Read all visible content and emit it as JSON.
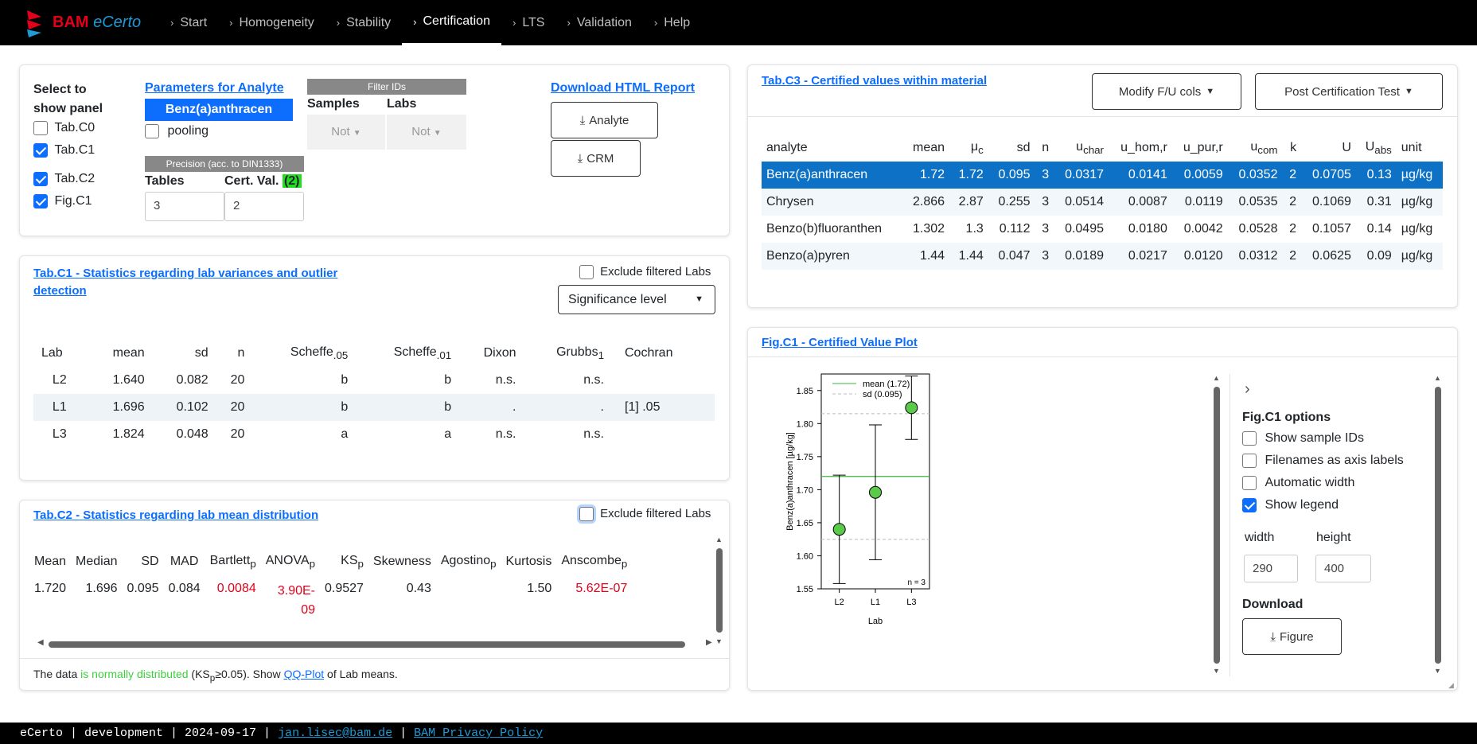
{
  "app": {
    "brand_a": "BAM",
    "brand_b": "eCerto"
  },
  "nav": {
    "items": [
      "Start",
      "Homogeneity",
      "Stability",
      "Certification",
      "LTS",
      "Validation",
      "Help"
    ],
    "active": "Certification"
  },
  "top": {
    "select_label": "Select to show panel",
    "checks": [
      {
        "label": "Tab.C0",
        "on": false
      },
      {
        "label": "Tab.C1",
        "on": true
      },
      {
        "label": "Tab.C2",
        "on": true
      },
      {
        "label": "Fig.C1",
        "on": true
      }
    ],
    "params_title": "Parameters for Analyte",
    "analyte": "Benz(a)anthracen",
    "pooling": "pooling",
    "filter_ids": "Filter IDs",
    "samples": "Samples",
    "labs": "Labs",
    "not1": "Not",
    "not2": "Not",
    "precision": "Precision (acc. to DIN1333)",
    "tables": "Tables",
    "cert_val": "Cert. Val.",
    "cert_badge": "(2)",
    "tables_val": "3",
    "cert_val_val": "2",
    "download_title": "Download HTML Report",
    "analyte_btn": "Analyte",
    "crm_btn": "CRM"
  },
  "c1": {
    "title_1": "Tab.C1 - Statistics regarding lab variances and outlier",
    "title_2": "detection",
    "exclude": "Exclude filtered Labs",
    "significance": "Significance level",
    "headers": [
      "Lab",
      "mean",
      "sd",
      "n",
      "Scheffe",
      "Scheffe",
      "Dixon",
      "Grubbs",
      "Cochran"
    ],
    "sub_05": ".05",
    "sub_01": ".01",
    "sub_1": "1",
    "rows": [
      [
        "L2",
        "1.640",
        "0.082",
        "20",
        "b",
        "b",
        "n.s.",
        "n.s.",
        ""
      ],
      [
        "L1",
        "1.696",
        "0.102",
        "20",
        "b",
        "b",
        ".",
        ".",
        "[1] .05"
      ],
      [
        "L3",
        "1.824",
        "0.048",
        "20",
        "a",
        "a",
        "n.s.",
        "n.s.",
        ""
      ]
    ]
  },
  "c2": {
    "title": "Tab.C2 - Statistics regarding lab mean distribution",
    "exclude": "Exclude filtered Labs",
    "headers": [
      "Mean",
      "Median",
      "SD",
      "MAD",
      "Bartlett",
      "ANOVA",
      "KS",
      "Skewness",
      "Agostino",
      "Kurtosis",
      "Anscombe"
    ],
    "sub_p": "p",
    "values": [
      "1.720",
      "1.696",
      "0.095",
      "0.084",
      "0.0084",
      "3.90E-09",
      "0.9527",
      "0.43",
      "",
      "1.50",
      "5.62E-07"
    ],
    "anova_1": "3.90E-",
    "anova_2": "09",
    "note_a": "The data ",
    "note_b": "is normally distributed",
    "note_c": " (KS",
    "note_p": "p",
    "note_d": "≥0.05). Show ",
    "note_link": "QQ-Plot",
    "note_e": " of Lab means."
  },
  "c3": {
    "title": "Tab.C3 - Certified values within material",
    "modify_btn": "Modify F/U cols",
    "post_btn": "Post Certification Test",
    "headers": [
      "analyte",
      "mean",
      "μ",
      "sd",
      "n",
      "u",
      "u_hom,r",
      "u_pur,r",
      "u",
      "k",
      "U",
      "U",
      "unit"
    ],
    "sub_c": "c",
    "sub_char": "char",
    "sub_com": "com",
    "sub_abs": "abs",
    "rows": [
      [
        "Benz(a)anthracen",
        "1.72",
        "1.72",
        "0.095",
        "3",
        "0.0317",
        "0.0141",
        "0.0059",
        "0.0352",
        "2",
        "0.0705",
        "0.13",
        "µg/kg"
      ],
      [
        "Chrysen",
        "2.866",
        "2.87",
        "0.255",
        "3",
        "0.0514",
        "0.0087",
        "0.0119",
        "0.0535",
        "2",
        "0.1069",
        "0.31",
        "µg/kg"
      ],
      [
        "Benzo(b)fluoranthen",
        "1.302",
        "1.3",
        "0.112",
        "3",
        "0.0495",
        "0.0180",
        "0.0042",
        "0.0528",
        "2",
        "0.1057",
        "0.14",
        "µg/kg"
      ],
      [
        "Benzo(a)pyren",
        "1.44",
        "1.44",
        "0.047",
        "3",
        "0.0189",
        "0.0217",
        "0.0120",
        "0.0312",
        "2",
        "0.0625",
        "0.09",
        "µg/kg"
      ]
    ]
  },
  "fig": {
    "title": "Fig.C1 - Certified Value Plot",
    "options_title": "Fig.C1 options",
    "opts": [
      {
        "label": "Show sample IDs",
        "on": false
      },
      {
        "label": "Filenames as axis labels",
        "on": false
      },
      {
        "label": "Automatic width",
        "on": false
      },
      {
        "label": "Show legend",
        "on": true
      }
    ],
    "width_label": "width",
    "height_label": "height",
    "width_val": "290",
    "height_val": "400",
    "download": "Download",
    "figure_btn": "Figure"
  },
  "chart_data": {
    "type": "scatter",
    "categories": [
      "L2",
      "L1",
      "L3"
    ],
    "values": [
      1.64,
      1.696,
      1.824
    ],
    "error_low": [
      1.558,
      1.594,
      1.776
    ],
    "error_high": [
      1.722,
      1.798,
      1.872
    ],
    "mean": 1.72,
    "sd": 0.095,
    "legend": [
      "mean (1.72)",
      "sd (0.095)"
    ],
    "annotation": "n = 3",
    "xlabel": "Lab",
    "ylabel": "Benz(a)anthracen [µg/kg]",
    "yticks": [
      "1.55",
      "1.60",
      "1.65",
      "1.70",
      "1.75",
      "1.80",
      "1.85"
    ],
    "ylim": [
      1.55,
      1.875
    ],
    "point_color": "#5bc94a",
    "mean_color": "#3cb43c"
  },
  "footer": {
    "text": "eCerto | development | 2024-09-17 | ",
    "email": "jan.lisec@bam.de",
    "sep": " | ",
    "privacy": "BAM Privacy Policy"
  }
}
